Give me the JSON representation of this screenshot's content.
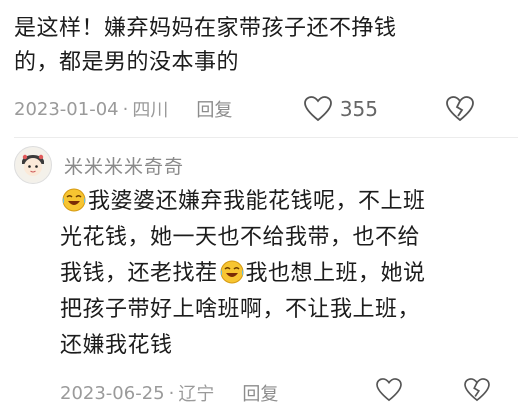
{
  "top_comment": {
    "line1": "是这样！嫌弃妈妈在家带孩子还不挣钱",
    "line2": "的，都是男的没本事的",
    "date": "2023-01-04",
    "location": "四川",
    "reply_label": "回复",
    "like_count": "355"
  },
  "reply_comment": {
    "username": "米米米米奇奇",
    "line1a": "我婆婆还嫌弃我能花钱呢，不上班",
    "line2": "光花钱，她一天也不给我带，也不给",
    "line3a": "我钱，还老找茬",
    "line3b": "我也想上班，她说",
    "line4": "把孩子带好上啥班啊，不让我上班，",
    "line5": "还嫌我花钱",
    "date": "2023-06-25",
    "location": "辽宁",
    "reply_label": "回复"
  },
  "separator": "·",
  "icons": {
    "like": "heart-icon",
    "dislike": "broken-heart-icon",
    "avatar": "avatar-icon",
    "emoji": "crying-laughing-emoji"
  }
}
